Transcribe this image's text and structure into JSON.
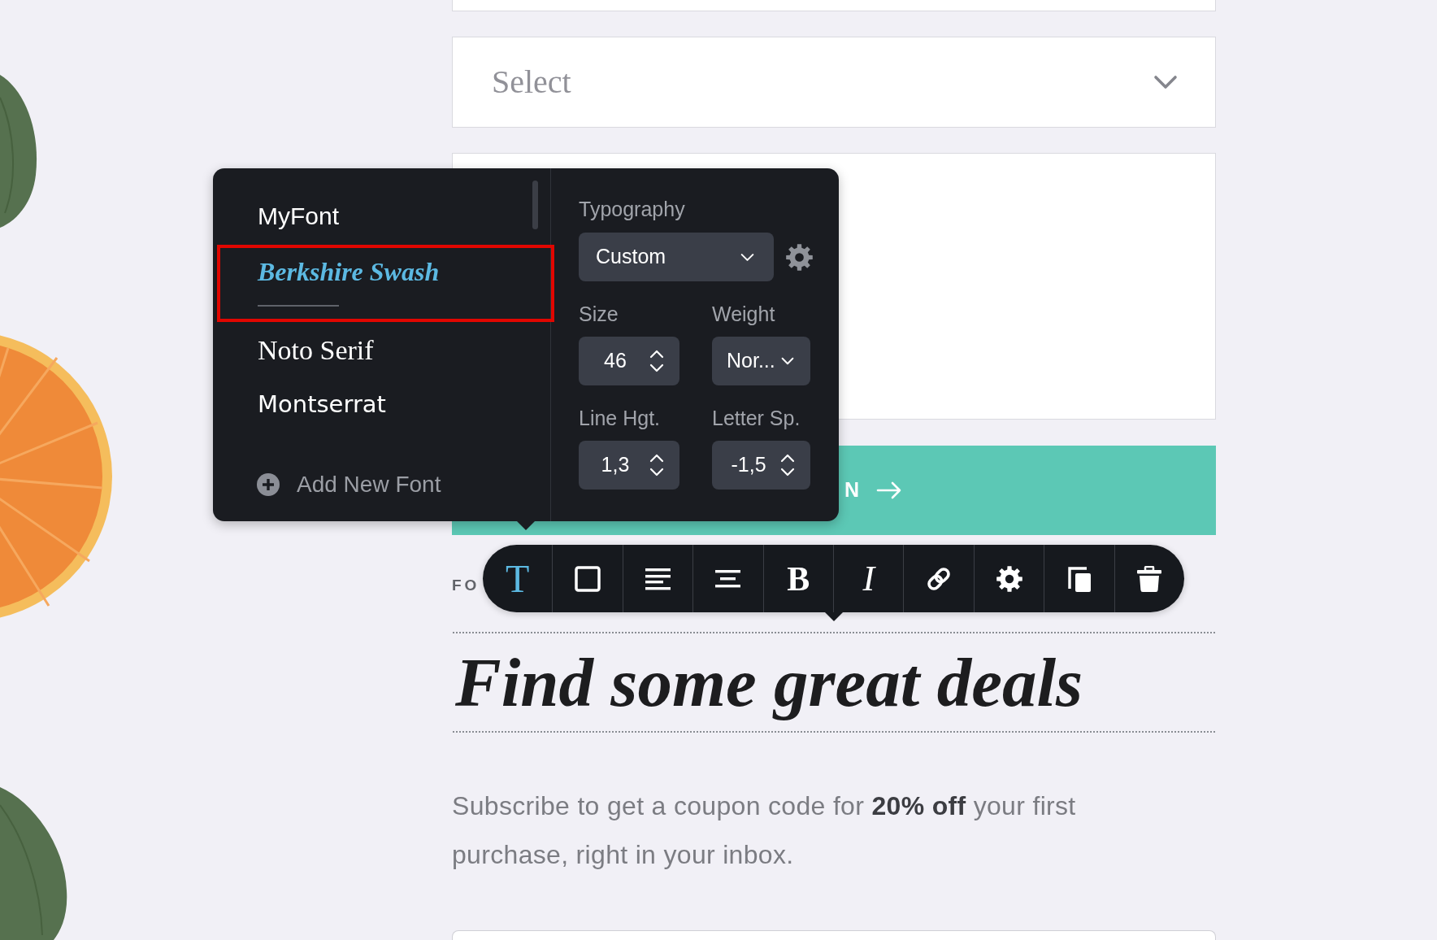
{
  "form": {
    "select": {
      "placeholder": "Select"
    },
    "button": {
      "label": "N"
    }
  },
  "font_panel": {
    "fonts": [
      {
        "label": "MyFont",
        "kind": "sans",
        "selected": false,
        "outlined": false
      },
      {
        "label": "Berkshire Swash",
        "kind": "script",
        "selected": true,
        "outlined": true
      },
      {
        "label": "Noto Serif",
        "kind": "serif",
        "selected": false,
        "outlined": false
      },
      {
        "label": "Montserrat",
        "kind": "geometric",
        "selected": false,
        "outlined": false
      }
    ],
    "add_font": "Add New Font",
    "typography": {
      "label": "Typography",
      "preset": "Custom"
    },
    "controls": [
      {
        "kind": "stepper",
        "label": "Size",
        "value": "46"
      },
      {
        "kind": "dropdown",
        "label": "Weight",
        "value": "Nor..."
      },
      {
        "kind": "stepper",
        "label": "Line Hgt.",
        "value": "1,3"
      },
      {
        "kind": "stepper",
        "label": "Letter Sp.",
        "value": "-1,5"
      }
    ]
  },
  "toolbar": {
    "items": [
      {
        "kind": "font",
        "label": "T",
        "selected": true
      },
      {
        "kind": "border",
        "selected": false
      },
      {
        "kind": "alignleft",
        "selected": false
      },
      {
        "kind": "aligncenter",
        "selected": false
      },
      {
        "kind": "bold",
        "label": "B",
        "selected": false
      },
      {
        "kind": "italic",
        "label": "I",
        "selected": false
      },
      {
        "kind": "link",
        "selected": false
      },
      {
        "kind": "settings",
        "selected": false
      },
      {
        "kind": "copy",
        "selected": false
      },
      {
        "kind": "delete",
        "selected": false
      }
    ]
  },
  "content": {
    "eyebrow": "FO",
    "heading": {
      "text": "Find some great deals",
      "selected": true
    },
    "body": "Subscribe to get a coupon code for **20% off** your first purchase, right in your inbox."
  }
}
